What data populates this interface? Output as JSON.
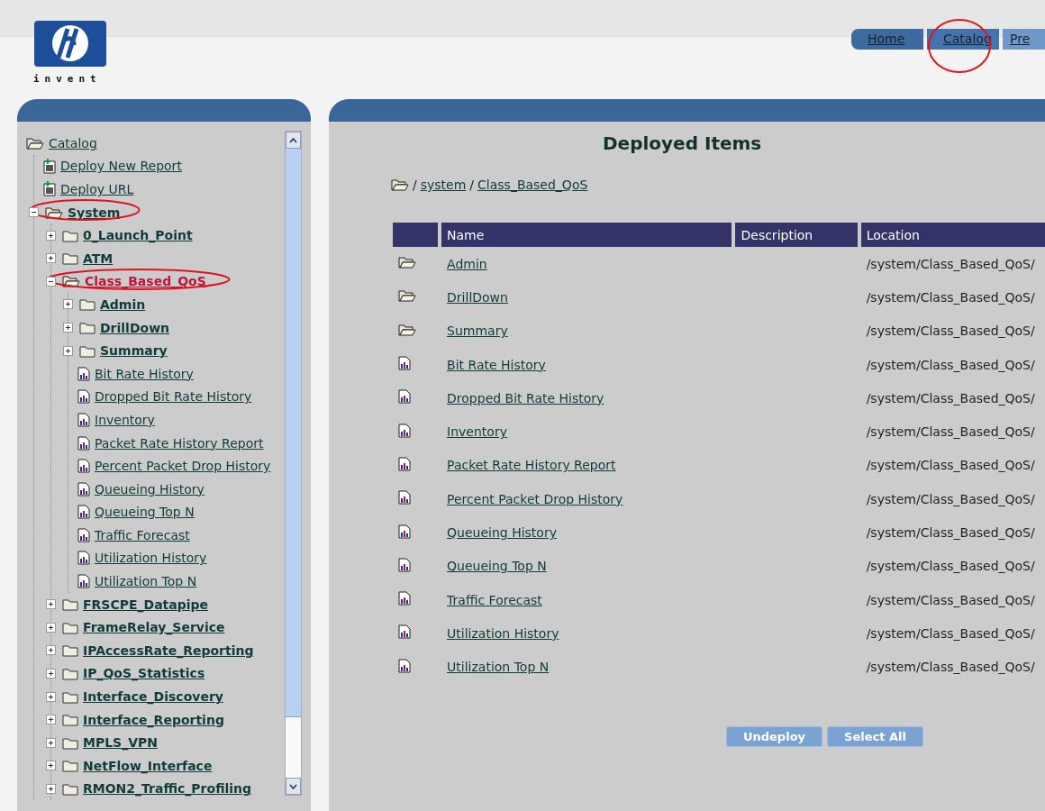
{
  "header": {
    "logo_tagline": "invent",
    "nav_tabs": [
      {
        "label": "Home",
        "selected": false,
        "circled": false
      },
      {
        "label": "Catalog",
        "selected": true,
        "circled": true
      },
      {
        "label": "Pre",
        "selected": false,
        "circled": false
      }
    ]
  },
  "tree": {
    "label": "Catalog",
    "kind": "root",
    "selected": false,
    "circled": false,
    "children": [
      {
        "label": "Deploy New Report",
        "kind": "action",
        "selected": false,
        "circled": false
      },
      {
        "label": "Deploy URL",
        "kind": "action",
        "selected": false,
        "circled": false
      },
      {
        "label": "System",
        "kind": "folder",
        "expanded": true,
        "selected": false,
        "circled": true,
        "children": [
          {
            "label": "0_Launch_Point",
            "kind": "folder",
            "expanded": false,
            "selected": false,
            "circled": false
          },
          {
            "label": "ATM",
            "kind": "folder",
            "expanded": false,
            "selected": false,
            "circled": false
          },
          {
            "label": "Class_Based_QoS",
            "kind": "folder",
            "expanded": true,
            "selected": true,
            "circled": true,
            "children": [
              {
                "label": "Admin",
                "kind": "folder",
                "expanded": false,
                "selected": false,
                "circled": false
              },
              {
                "label": "DrillDown",
                "kind": "folder",
                "expanded": false,
                "selected": false,
                "circled": false
              },
              {
                "label": "Summary",
                "kind": "folder",
                "expanded": false,
                "selected": false,
                "circled": false
              },
              {
                "label": "Bit Rate History",
                "kind": "report",
                "selected": false,
                "circled": false
              },
              {
                "label": "Dropped Bit Rate History",
                "kind": "report",
                "selected": false,
                "circled": false
              },
              {
                "label": "Inventory",
                "kind": "report",
                "selected": false,
                "circled": false
              },
              {
                "label": "Packet Rate History Report",
                "kind": "report",
                "selected": false,
                "circled": false
              },
              {
                "label": "Percent Packet Drop History",
                "kind": "report",
                "selected": false,
                "circled": false
              },
              {
                "label": "Queueing History",
                "kind": "report",
                "selected": false,
                "circled": false
              },
              {
                "label": "Queueing Top N",
                "kind": "report",
                "selected": false,
                "circled": false
              },
              {
                "label": "Traffic Forecast",
                "kind": "report",
                "selected": false,
                "circled": false
              },
              {
                "label": "Utilization History",
                "kind": "report",
                "selected": false,
                "circled": false
              },
              {
                "label": "Utilization Top N",
                "kind": "report",
                "selected": false,
                "circled": false
              }
            ]
          },
          {
            "label": "FRSCPE_Datapipe",
            "kind": "folder",
            "expanded": false,
            "selected": false,
            "circled": false
          },
          {
            "label": "FrameRelay_Service",
            "kind": "folder",
            "expanded": false,
            "selected": false,
            "circled": false
          },
          {
            "label": "IPAccessRate_Reporting",
            "kind": "folder",
            "expanded": false,
            "selected": false,
            "circled": false
          },
          {
            "label": "IP_QoS_Statistics",
            "kind": "folder",
            "expanded": false,
            "selected": false,
            "circled": false
          },
          {
            "label": "Interface_Discovery",
            "kind": "folder",
            "expanded": false,
            "selected": false,
            "circled": false
          },
          {
            "label": "Interface_Reporting",
            "kind": "folder",
            "expanded": false,
            "selected": false,
            "circled": false
          },
          {
            "label": "MPLS_VPN",
            "kind": "folder",
            "expanded": false,
            "selected": false,
            "circled": false
          },
          {
            "label": "NetFlow_Interface",
            "kind": "folder",
            "expanded": false,
            "selected": false,
            "circled": false
          },
          {
            "label": "RMON2_Traffic_Profiling",
            "kind": "folder",
            "expanded": false,
            "selected": false,
            "circled": false
          }
        ]
      }
    ]
  },
  "main": {
    "title": "Deployed Items",
    "breadcrumb": [
      "/",
      "system",
      "/",
      "Class_Based_QoS"
    ],
    "table": {
      "columns": [
        "Name",
        "Description",
        "Location"
      ],
      "rows": [
        {
          "kind": "folder",
          "name": "Admin",
          "location": "/system/Class_Based_QoS/"
        },
        {
          "kind": "folder",
          "name": "DrillDown",
          "location": "/system/Class_Based_QoS/"
        },
        {
          "kind": "folder",
          "name": "Summary",
          "location": "/system/Class_Based_QoS/"
        },
        {
          "kind": "report",
          "name": "Bit Rate History",
          "location": "/system/Class_Based_QoS/"
        },
        {
          "kind": "report",
          "name": "Dropped Bit Rate History",
          "location": "/system/Class_Based_QoS/"
        },
        {
          "kind": "report",
          "name": "Inventory",
          "location": "/system/Class_Based_QoS/"
        },
        {
          "kind": "report",
          "name": "Packet Rate History Report",
          "location": "/system/Class_Based_QoS/"
        },
        {
          "kind": "report",
          "name": "Percent Packet Drop History",
          "location": "/system/Class_Based_QoS/"
        },
        {
          "kind": "report",
          "name": "Queueing History",
          "location": "/system/Class_Based_QoS/"
        },
        {
          "kind": "report",
          "name": "Queueing Top N",
          "location": "/system/Class_Based_QoS/"
        },
        {
          "kind": "report",
          "name": "Traffic Forecast",
          "location": "/system/Class_Based_QoS/"
        },
        {
          "kind": "report",
          "name": "Utilization History",
          "location": "/system/Class_Based_QoS/"
        },
        {
          "kind": "report",
          "name": "Utilization Top N",
          "location": "/system/Class_Based_QoS/"
        }
      ]
    },
    "buttons": [
      "Undeploy",
      "Select All"
    ]
  }
}
